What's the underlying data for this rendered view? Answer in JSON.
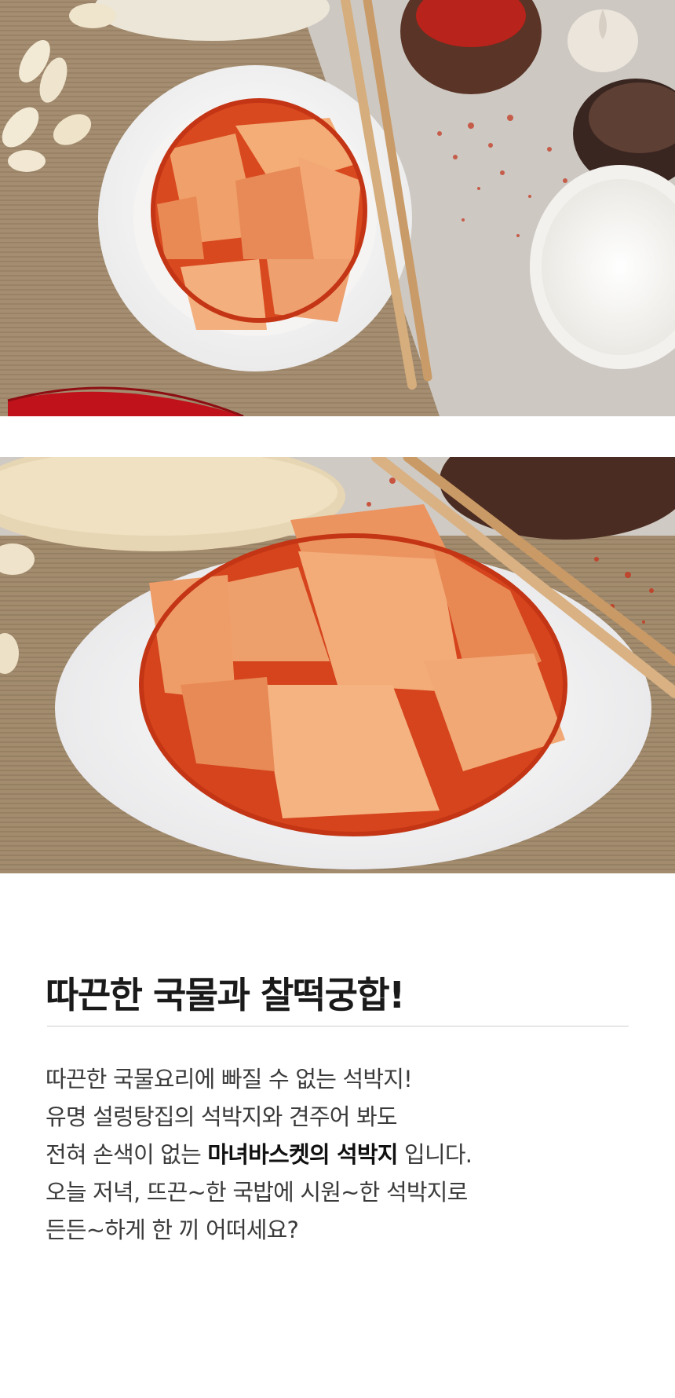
{
  "images": {
    "top_photo": {
      "icon": "kimchi-top-view-photo"
    },
    "bottom_photo": {
      "icon": "kimchi-close-up-photo"
    }
  },
  "heading": {
    "title": "따끈한 국물과 찰떡궁합!"
  },
  "description": {
    "line1": "따끈한 국물요리에 빠질 수 없는 석박지!",
    "line2": "유명 설렁탕집의 석박지와 견주어 봐도",
    "line3_before": "전혀 손색이 없는 ",
    "line3_brand": "마녀바스켓의 석박지",
    "line3_after": " 입니다.",
    "line4": "오늘 저녁, 뜨끈~한 국밥에 시원~한 석박지로",
    "line5": "든든~하게 한 끼 어떠세요?"
  },
  "colors": {
    "background": "#ffffff",
    "kimchi_red": "#d9491f",
    "radish": "#f2b07a",
    "placemat": "#a08a6c",
    "table": "#cfcac4"
  }
}
